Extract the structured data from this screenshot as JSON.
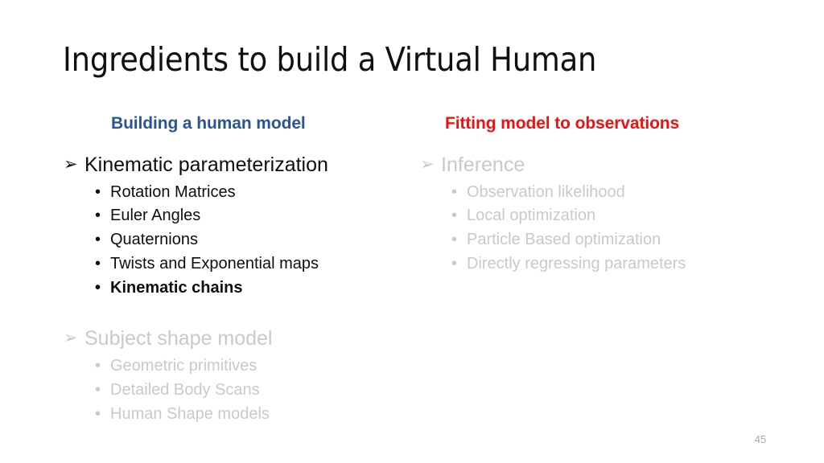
{
  "slide": {
    "title": "Ingredients to build a Virtual Human",
    "number": "45",
    "background_color": "#FFFFFF"
  },
  "columns": {
    "left": {
      "heading": "Building a human model",
      "heading_color": "#2A5398",
      "groups": [
        {
          "title": "Kinematic parameterization",
          "bullet_glyph": "➢",
          "dimmed": false,
          "text_color": "#0E0E0E",
          "items": [
            {
              "label": "Rotation Matrices",
              "bold": false
            },
            {
              "label": "Euler Angles",
              "bold": false
            },
            {
              "label": "Quaternions",
              "bold": false
            },
            {
              "label": "Twists and Exponential maps",
              "bold": false
            },
            {
              "label": "Kinematic chains",
              "bold": true
            }
          ]
        },
        {
          "title": "Subject shape model",
          "bullet_glyph": "➢",
          "dimmed": true,
          "text_color": "#C9C9C9",
          "items": [
            {
              "label": "Geometric primitives",
              "bold": false
            },
            {
              "label": "Detailed Body Scans",
              "bold": false
            },
            {
              "label": "Human Shape models",
              "bold": false
            }
          ]
        }
      ]
    },
    "right": {
      "heading": "Fitting model to observations",
      "heading_color": "#EE1111",
      "groups": [
        {
          "title": "Inference",
          "bullet_glyph": "➢",
          "dimmed": true,
          "text_color": "#C9C9C9",
          "items": [
            {
              "label": "Observation likelihood",
              "bold": false
            },
            {
              "label": "Local optimization",
              "bold": false
            },
            {
              "label": "Particle Based optimization",
              "bold": false
            },
            {
              "label": "Directly regressing parameters",
              "bold": false
            }
          ]
        }
      ]
    }
  },
  "icons": {
    "arrow_bullet": "➢",
    "round_bullet": "•"
  }
}
